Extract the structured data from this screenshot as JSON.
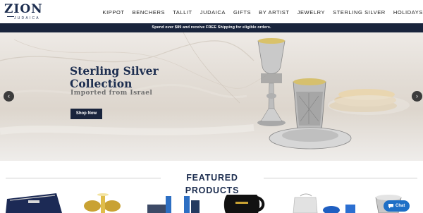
{
  "logo": {
    "main": "ZION",
    "sub": "JUDAICA"
  },
  "nav": [
    "KIPPOT",
    "BENCHERS",
    "TALLIT",
    "JUDAICA",
    "GIFTS",
    "BY ARTIST",
    "JEWELRY",
    "STERLING SILVER",
    "HOLIDAYS"
  ],
  "promo": {
    "text": "Spend over $89 and receive FREE Shipping for eligible orders."
  },
  "hero": {
    "title": "Sterling Silver Collection",
    "subtitle": "Imported from Israel",
    "button": "Shop Now",
    "prev_icon": "chevron-left-icon",
    "next_icon": "chevron-right-icon"
  },
  "featured": {
    "title": "FEATURED PRODUCTS"
  },
  "chat": {
    "label": "Chat",
    "icon": "chat-bubble-icon"
  },
  "colors": {
    "navy": "#19243c",
    "brand": "#1c2d4f",
    "chat": "#1e6fc6"
  }
}
